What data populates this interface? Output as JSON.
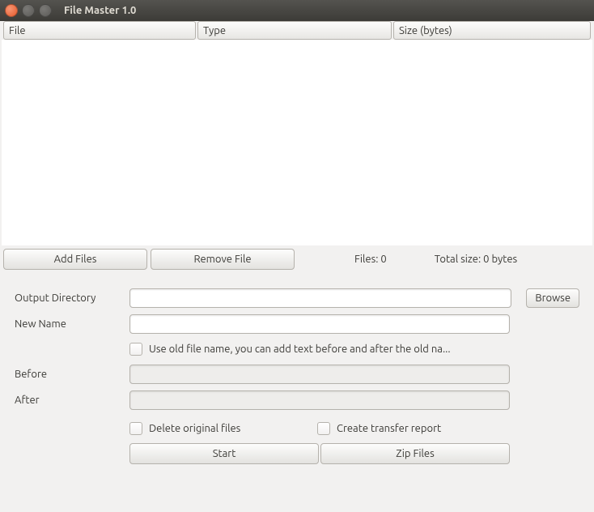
{
  "window": {
    "title": "File Master 1.0"
  },
  "table": {
    "columns": {
      "file": "File",
      "type": "Type",
      "size": "Size (bytes)"
    },
    "rows": []
  },
  "toolbar": {
    "add_files": "Add Files",
    "remove_file": "Remove File",
    "files_label": "Files:",
    "files_count": "0",
    "total_label": "Total size:",
    "total_value": "0 bytes"
  },
  "form": {
    "output_dir_label": "Output Directory",
    "output_dir_value": "",
    "browse": "Browse",
    "new_name_label": "New Name",
    "new_name_value": "",
    "use_old_name": "Use old file name, you can add text before and after the old na...",
    "before_label": "Before",
    "before_value": "",
    "after_label": "After",
    "after_value": "",
    "delete_originals": "Delete original files",
    "create_report": "Create transfer report",
    "start": "Start",
    "zip_files": "Zip Files"
  }
}
